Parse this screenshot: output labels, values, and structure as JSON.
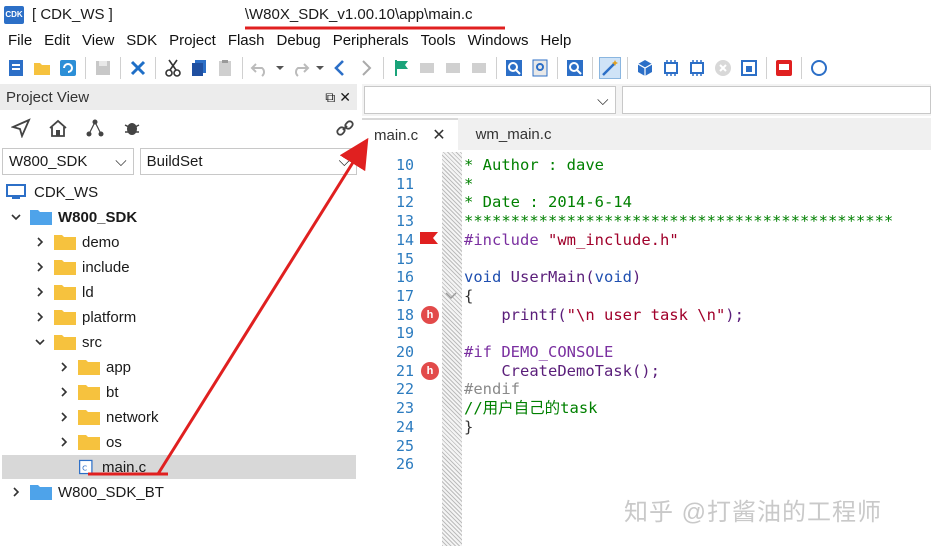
{
  "window": {
    "title_left": "[ CDK_WS ]",
    "title_right": "\\W80X_SDK_v1.00.10\\app\\main.c",
    "app_icon_label": "CDK"
  },
  "menu": [
    "File",
    "Edit",
    "View",
    "SDK",
    "Project",
    "Flash",
    "Debug",
    "Peripherals",
    "Tools",
    "Windows",
    "Help"
  ],
  "project_view": {
    "title": "Project View",
    "project_select": "W800_SDK",
    "buildset_select": "BuildSet",
    "tree": [
      {
        "label": "CDK_WS",
        "type": "workspace"
      },
      {
        "label": "W800_SDK",
        "type": "project"
      },
      {
        "label": "demo",
        "type": "folder"
      },
      {
        "label": "include",
        "type": "folder"
      },
      {
        "label": "ld",
        "type": "folder"
      },
      {
        "label": "platform",
        "type": "folder"
      },
      {
        "label": "src",
        "type": "folder"
      },
      {
        "label": "app",
        "type": "folder"
      },
      {
        "label": "bt",
        "type": "folder"
      },
      {
        "label": "network",
        "type": "folder"
      },
      {
        "label": "os",
        "type": "folder"
      },
      {
        "label": "main.c",
        "type": "file"
      },
      {
        "label": "W800_SDK_BT",
        "type": "project"
      }
    ]
  },
  "editor": {
    "tabs": [
      {
        "label": "main.c",
        "active": true
      },
      {
        "label": "wm_main.c",
        "active": false
      }
    ],
    "line_numbers": [
      "10",
      "11",
      "12",
      "13",
      "14",
      "15",
      "16",
      "17",
      "18",
      "19",
      "20",
      "21",
      "22",
      "23",
      "24",
      "25",
      "26"
    ],
    "lines": {
      "l10": "* Author : dave",
      "l11": "*",
      "l12": "* Date : 2014-6-14",
      "l13": "**********************************************",
      "l14_a": "#include ",
      "l14_b": "\"wm_include.h\"",
      "l16_a": "void",
      "l16_b": " UserMain(",
      "l16_c": "void",
      "l16_d": ")",
      "l17": "{",
      "l18_a": "    printf(",
      "l18_b": "\"\\n user task \\n\"",
      "l18_c": ");",
      "l20_a": "#if ",
      "l20_b": "DEMO_CONSOLE",
      "l21": "    CreateDemoTask();",
      "l22": "#endif",
      "l23": "//用户自己的task",
      "l24": "}"
    },
    "marker_label": "h"
  },
  "watermark": "知乎 @打酱油的工程师",
  "colors": {
    "accent": "#2c6fc7",
    "annotation": "#e02020",
    "folder": "#f6c23e"
  }
}
